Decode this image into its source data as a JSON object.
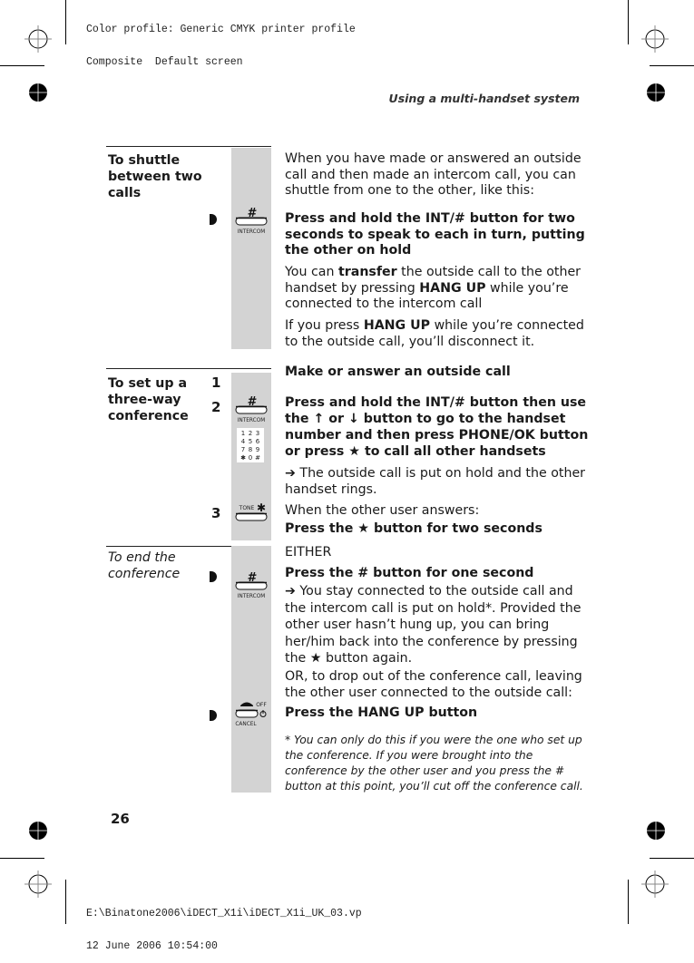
{
  "print_info": {
    "top_line1": "Color profile: Generic CMYK printer profile",
    "top_line2": "Composite  Default screen",
    "bottom_line1": "E:\\Binatone2006\\iDECT_X1i\\iDECT_X1i_UK_03.vp",
    "bottom_line2": "12 June 2006 10:54:00"
  },
  "running_head": "Using a multi-handset system",
  "page_number": "26",
  "icons": {
    "intercom_label": "INTERCOM",
    "intercom_symbol": "#",
    "tone_label": "TONE",
    "tone_symbol": "✱",
    "off_label": "OFF",
    "cancel_label": "CANCEL",
    "keypad": [
      "1",
      "2",
      "3",
      "4",
      "5",
      "6",
      "7",
      "8",
      "9",
      "✱",
      "0",
      "#"
    ]
  },
  "sections": [
    {
      "title": "To shuttle between two calls",
      "title_lines": [
        "To shuttle",
        "between two",
        "calls"
      ],
      "intro": "When you have made or answered an outside call and then made an intercom call, you can shuttle from one to the other, like this:",
      "step_parts": [
        "Press and hold the ",
        "INT",
        "/# button for two seconds  to speak to each in turn, putting the other on hold"
      ],
      "para1_parts": [
        "You can ",
        "transfer",
        " the outside call to the other handset by pressing ",
        "HANG UP",
        " while you’re connected to the intercom call"
      ],
      "para2_parts": [
        "If you press ",
        "HANG UP",
        " while you’re connected to the outside call, you’ll disconnect it."
      ]
    },
    {
      "title": "To set up a three-way conference",
      "title_lines": [
        "To set up a",
        "three-way",
        "conference"
      ],
      "steps": [
        {
          "num": "1",
          "text": "Make or answer an outside call"
        },
        {
          "num": "2",
          "parts": [
            "Press and hold the ",
            "INT",
            "/# button then use the ↑ or ↓ button to go to the  handset number  and then press PHONE/OK button or press ★ to call all other handsets"
          ],
          "result": "➔ The outside call is put on hold and the other handset rings."
        },
        {
          "num": "3",
          "pre": "When the other user answers:",
          "text": "Press the ★ button for two seconds"
        }
      ]
    },
    {
      "title": "To end the conference",
      "title_lines": [
        "To end the",
        "conference"
      ],
      "either": "EITHER",
      "option1": "Press the # button for one second",
      "option1_result": "➔ You stay connected to the outside call and the intercom call is put on hold*. Provided the other user hasn’t hung up, you can bring her/him back into the conference by pressing the ★ button again.",
      "or_text": "OR, to drop out of the conference call, leaving the other user connected to the outside call:",
      "option2_parts": [
        "Press the ",
        "HANG UP",
        " button"
      ],
      "footnote": "* You can only do this if you were the one who set up the conference. If you were brought into the conference by the other user and you press the # button at this point, you’ll cut off the conference call."
    }
  ]
}
